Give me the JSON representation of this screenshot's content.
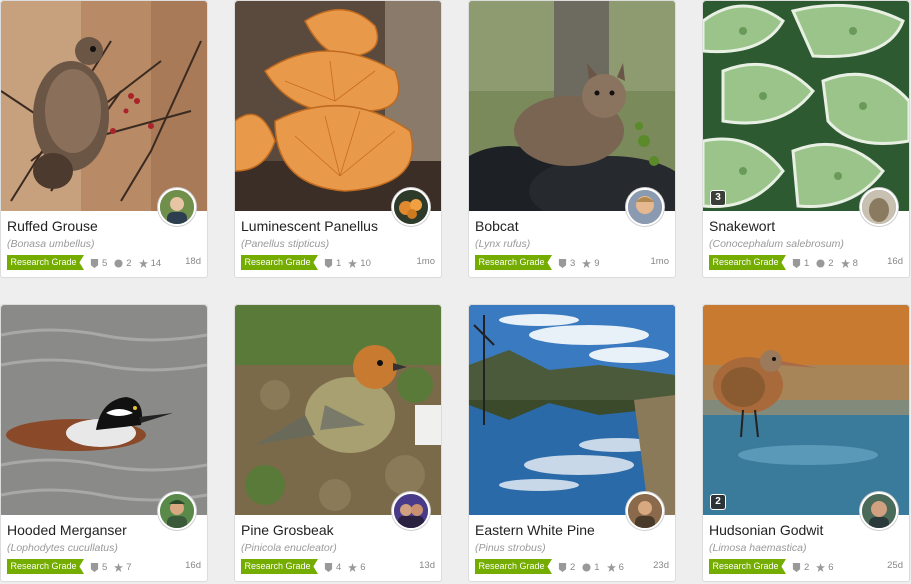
{
  "cards": [
    {
      "title": "Ruffed Grouse",
      "sci": "(Bonasa umbellus)",
      "badge": "Research Grade",
      "ids": "5",
      "comments": "2",
      "faves": "14",
      "age": "18d",
      "photo_count": ""
    },
    {
      "title": "Luminescent Panellus",
      "sci": "(Panellus stipticus)",
      "badge": "Research Grade",
      "ids": "1",
      "comments": "",
      "faves": "10",
      "age": "1mo",
      "photo_count": ""
    },
    {
      "title": "Bobcat",
      "sci": "(Lynx rufus)",
      "badge": "Research Grade",
      "ids": "3",
      "comments": "",
      "faves": "9",
      "age": "1mo",
      "photo_count": ""
    },
    {
      "title": "Snakewort",
      "sci": "(Conocephalum salebrosum)",
      "badge": "Research Grade",
      "ids": "1",
      "comments": "2",
      "faves": "8",
      "age": "16d",
      "photo_count": "3"
    },
    {
      "title": "Hooded Merganser",
      "sci": "(Lophodytes cucullatus)",
      "badge": "Research Grade",
      "ids": "5",
      "comments": "",
      "faves": "7",
      "age": "16d",
      "photo_count": ""
    },
    {
      "title": "Pine Grosbeak",
      "sci": "(Pinicola enucleator)",
      "badge": "Research Grade",
      "ids": "4",
      "comments": "",
      "faves": "6",
      "age": "13d",
      "photo_count": ""
    },
    {
      "title": "Eastern White Pine",
      "sci": "(Pinus strobus)",
      "badge": "Research Grade",
      "ids": "2",
      "comments": "1",
      "faves": "6",
      "age": "23d",
      "photo_count": ""
    },
    {
      "title": "Hudsonian Godwit",
      "sci": "(Limosa haemastica)",
      "badge": "Research Grade",
      "ids": "2",
      "comments": "",
      "faves": "6",
      "age": "25d",
      "photo_count": "2"
    }
  ],
  "colors": {
    "badge": "#74ac00",
    "background": "#eeeeee"
  }
}
